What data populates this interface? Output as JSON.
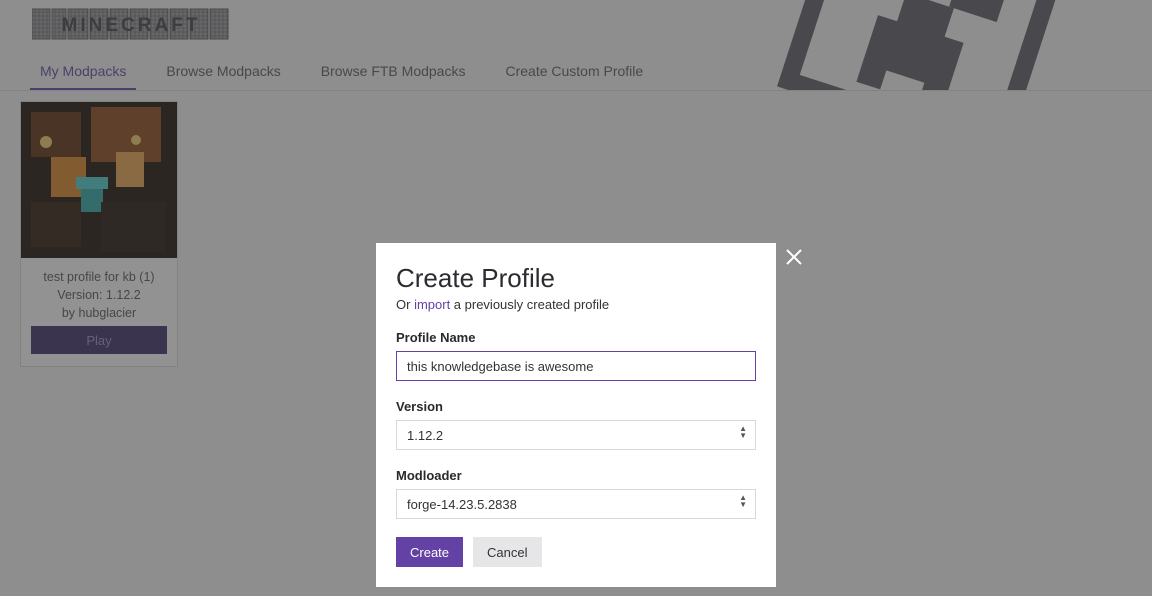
{
  "header": {
    "logo_text": "MINECRAFT"
  },
  "tabs": {
    "items": [
      {
        "label": "My Modpacks",
        "active": true
      },
      {
        "label": "Browse Modpacks",
        "active": false
      },
      {
        "label": "Browse FTB Modpacks",
        "active": false
      },
      {
        "label": "Create Custom Profile",
        "active": false
      }
    ]
  },
  "card": {
    "title": "test profile for kb (1)",
    "version_line": "Version: 1.12.2",
    "author_line": "by hubglacier",
    "play_label": "Play"
  },
  "modal": {
    "title": "Create Profile",
    "sub_prefix": "Or ",
    "import_link": "import",
    "sub_suffix": " a previously created profile",
    "profile_name_label": "Profile Name",
    "profile_name_value": "this knowledgebase is awesome",
    "version_label": "Version",
    "version_value": "1.12.2",
    "modloader_label": "Modloader",
    "modloader_value": "forge-14.23.5.2838",
    "create_label": "Create",
    "cancel_label": "Cancel"
  }
}
